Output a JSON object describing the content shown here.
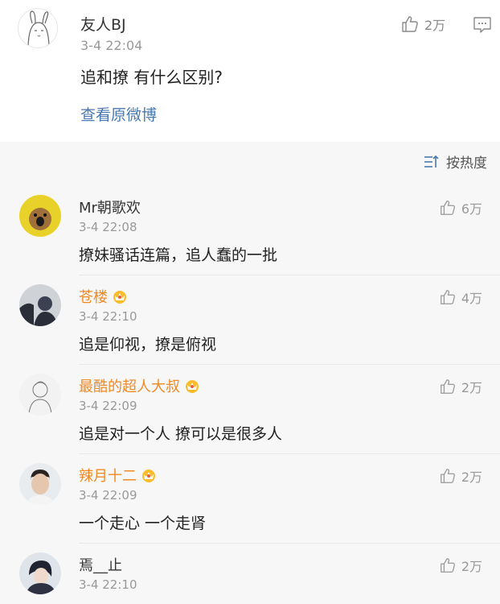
{
  "post": {
    "author": "友人BJ",
    "time": "3-4 22:04",
    "text": "追和撩 有什么区别?",
    "view_original": "查看原微博",
    "likes": "2万"
  },
  "sort": {
    "label": "按热度"
  },
  "comments": [
    {
      "name": "Mr朝歌欢",
      "vip": false,
      "time": "3-4 22:08",
      "text": "撩妹骚话连篇，追人蠢的一批",
      "likes": "6万",
      "avatar_color": "#e8d22a"
    },
    {
      "name": "苍楼",
      "vip": true,
      "time": "3-4 22:10",
      "text": "追是仰视，撩是俯视",
      "likes": "4万",
      "avatar_color": "#3b4150"
    },
    {
      "name": "最酷的超人大叔",
      "vip": true,
      "time": "3-4 22:09",
      "text": "追是对一个人 撩可以是很多人",
      "likes": "2万",
      "avatar_color": "#dcdcdc"
    },
    {
      "name": "辣月十二",
      "vip": true,
      "time": "3-4 22:09",
      "text": "一个走心 一个走肾",
      "likes": "2万",
      "avatar_color": "#c9b4a3"
    },
    {
      "name": "焉__止",
      "vip": false,
      "time": "3-4 22:10",
      "text": "",
      "likes": "2万",
      "avatar_color": "#2d3142"
    }
  ],
  "colors": {
    "vip_name": "#f08a24",
    "link": "#4a78b0",
    "muted": "#999999"
  },
  "icons": {
    "like": "thumbs-up-icon",
    "comment": "comment-icon",
    "sort": "sort-icon",
    "vip": "crown-icon"
  }
}
